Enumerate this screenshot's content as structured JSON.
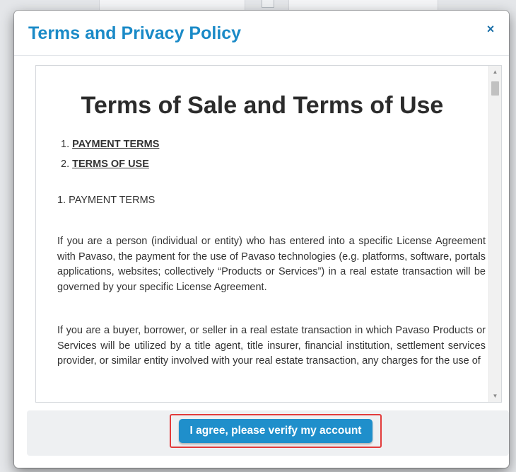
{
  "modal": {
    "title": "Terms and Privacy Policy",
    "close_glyph": "×"
  },
  "document": {
    "heading": "Terms of Sale and Terms of Use",
    "toc": [
      {
        "number": "1.",
        "label": "PAYMENT TERMS"
      },
      {
        "number": "2.",
        "label": "TERMS OF USE"
      }
    ],
    "section_label": "1. PAYMENT TERMS",
    "paragraphs": [
      "If you are a person (individual or entity) who has entered into a specific License Agreement with Pavaso, the payment for the use of Pavaso technologies (e.g. platforms, software, portals applications, websites; collectively “Products or Services”) in a real estate transaction will be governed by your specific License Agreement.",
      "If you are a buyer, borrower, or seller in a real estate transaction in which Pavaso Products or Services will be utilized by a title agent, title insurer, financial institution, settlement services provider, or similar entity involved with your real estate transaction, any charges for the use of"
    ]
  },
  "scrollbar": {
    "up_arrow": "▲",
    "down_arrow": "▼"
  },
  "footer": {
    "agree_label": "I agree, please verify my account"
  },
  "colors": {
    "title": "#1a8ac7",
    "button": "#1f8fcb",
    "highlight": "#e23b3b"
  }
}
